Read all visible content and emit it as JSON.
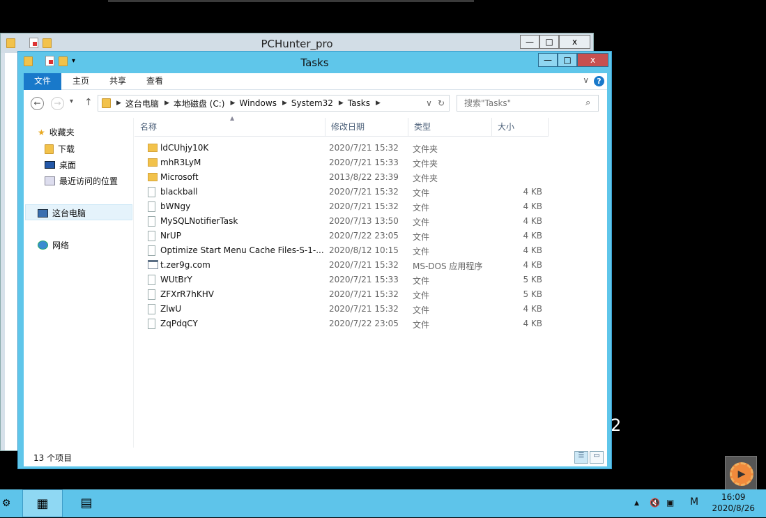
{
  "bg_window": {
    "title": "PCHunter_pro"
  },
  "bg_digit": "2",
  "window": {
    "title": "Tasks",
    "controls": {
      "minimize": "—",
      "maximize": "□",
      "close": "x"
    }
  },
  "ribbon": {
    "tabs": [
      "文件",
      "主页",
      "共享",
      "查看"
    ],
    "help": "?",
    "expand": "∨"
  },
  "nav": {
    "back": "←",
    "forward": "→",
    "recent": "▾",
    "up": "↑",
    "refresh": "↻",
    "dropdown": "∨"
  },
  "address": {
    "crumbs": [
      "这台电脑",
      "本地磁盘 (C:)",
      "Windows",
      "System32",
      "Tasks"
    ],
    "sep": "▶"
  },
  "search": {
    "placeholder": "搜索\"Tasks\"",
    "icon": "⌕"
  },
  "navpane": {
    "favorites": "收藏夹",
    "downloads": "下载",
    "desktop": "桌面",
    "recent": "最近访问的位置",
    "thispc": "这台电脑",
    "network": "网络"
  },
  "columns": {
    "name": "名称",
    "date": "修改日期",
    "type": "类型",
    "size": "大小",
    "sort": "▲"
  },
  "files": [
    {
      "name": "ldCUhjy10K",
      "date": "2020/7/21 15:32",
      "type": "文件夹",
      "size": "",
      "kind": "folder"
    },
    {
      "name": "mhR3LyM",
      "date": "2020/7/21 15:33",
      "type": "文件夹",
      "size": "",
      "kind": "folder"
    },
    {
      "name": "Microsoft",
      "date": "2013/8/22 23:39",
      "type": "文件夹",
      "size": "",
      "kind": "folder"
    },
    {
      "name": "blackball",
      "date": "2020/7/21 15:32",
      "type": "文件",
      "size": "4 KB",
      "kind": "file"
    },
    {
      "name": "bWNgy",
      "date": "2020/7/21 15:32",
      "type": "文件",
      "size": "4 KB",
      "kind": "file"
    },
    {
      "name": "MySQLNotifierTask",
      "date": "2020/7/13 13:50",
      "type": "文件",
      "size": "4 KB",
      "kind": "file"
    },
    {
      "name": "NrUP",
      "date": "2020/7/22 23:05",
      "type": "文件",
      "size": "4 KB",
      "kind": "file"
    },
    {
      "name": "Optimize Start Menu Cache Files-S-1-...",
      "date": "2020/8/12 10:15",
      "type": "文件",
      "size": "4 KB",
      "kind": "file"
    },
    {
      "name": "t.zer9g.com",
      "date": "2020/7/21 15:32",
      "type": "MS-DOS 应用程序",
      "size": "4 KB",
      "kind": "exe"
    },
    {
      "name": "WUtBrY",
      "date": "2020/7/21 15:33",
      "type": "文件",
      "size": "5 KB",
      "kind": "file"
    },
    {
      "name": "ZFXrR7hKHV",
      "date": "2020/7/21 15:32",
      "type": "文件",
      "size": "5 KB",
      "kind": "file"
    },
    {
      "name": "ZlwU",
      "date": "2020/7/21 15:32",
      "type": "文件",
      "size": "4 KB",
      "kind": "file"
    },
    {
      "name": "ZqPdqCY",
      "date": "2020/7/22 23:05",
      "type": "文件",
      "size": "4 KB",
      "kind": "file"
    }
  ],
  "status": {
    "count": "13 个项目"
  },
  "taskbar": {
    "up_arrow": "▲",
    "ime": "M",
    "time": "16:09",
    "date": "2020/8/26"
  },
  "colors": {
    "accent": "#1979ca",
    "titlebar": "#5fc6ea",
    "taskbar": "#5ec4ea",
    "close": "#c75050"
  }
}
